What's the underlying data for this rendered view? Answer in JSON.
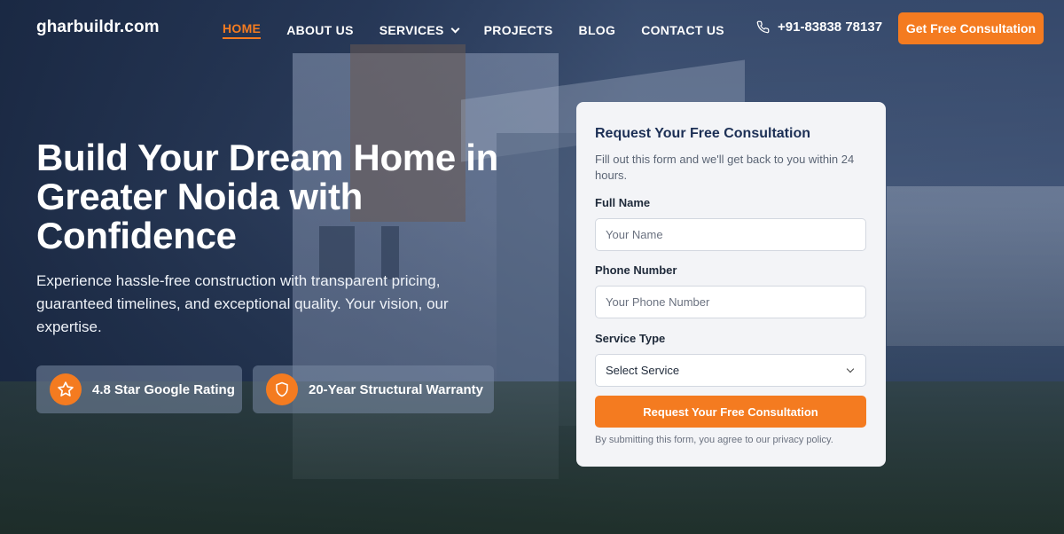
{
  "nav": {
    "logo": "gharbuildr.com",
    "items": [
      {
        "label": "HOME",
        "active": true
      },
      {
        "label": "ABOUT US"
      },
      {
        "label": "SERVICES",
        "has_dropdown": true
      },
      {
        "label": "PROJECTS"
      },
      {
        "label": "BLOG"
      },
      {
        "label": "CONTACT US"
      }
    ],
    "phone": "+91-83838 78137",
    "cta_label": "Get Free Consultation"
  },
  "hero": {
    "headline": "Build Your Dream Home in Greater Noida with Confidence",
    "subtext": "Experience hassle-free construction with transparent pricing, guaranteed timelines, and exceptional quality. Your vision, our expertise.",
    "badges": [
      {
        "icon": "star-icon",
        "label": "4.8 Star Google Rating"
      },
      {
        "icon": "shield-icon",
        "label": "20-Year Structural Warranty"
      }
    ]
  },
  "form": {
    "title": "Request Your Free Consultation",
    "description": "Fill out this form and we'll get back to you within 24 hours.",
    "name_label": "Full Name",
    "name_placeholder": "Your Name",
    "phone_label": "Phone Number",
    "phone_placeholder": "Your Phone Number",
    "service_label": "Service Type",
    "service_selected": "Select Service",
    "submit_label": "Request Your Free Consultation",
    "disclaimer": "By submitting this form, you agree to our privacy policy."
  },
  "colors": {
    "accent": "#f47b20",
    "heading_navy": "#1c2f55"
  }
}
